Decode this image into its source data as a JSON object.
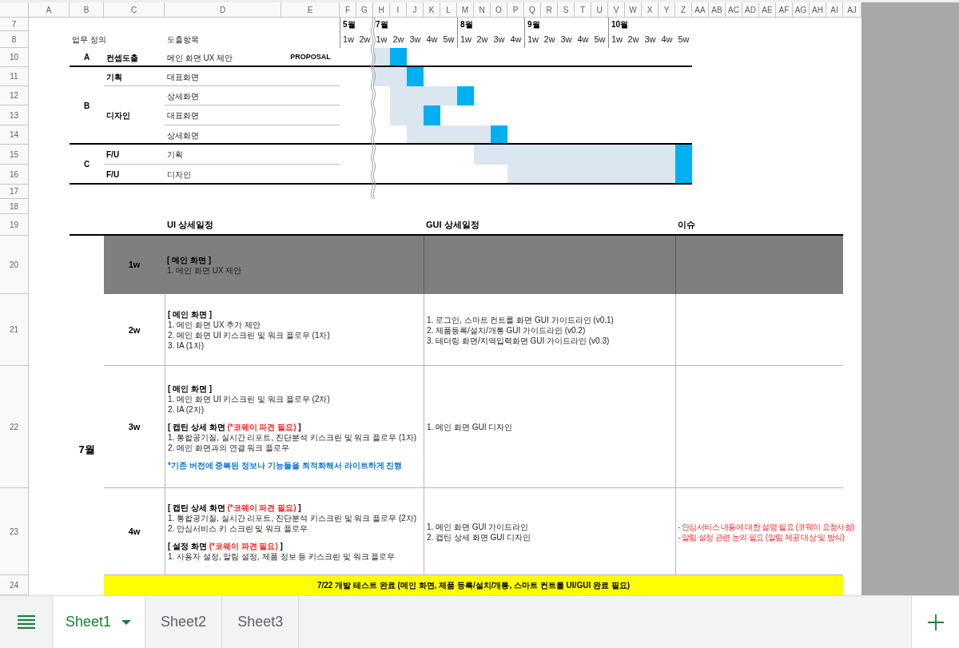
{
  "columns": [
    "A",
    "B",
    "C",
    "D",
    "E",
    "F",
    "G",
    "H",
    "I",
    "J",
    "K",
    "L",
    "M",
    "N",
    "O",
    "P",
    "Q",
    "R",
    "S",
    "T",
    "U",
    "V",
    "W",
    "X",
    "Y",
    "Z",
    "AA",
    "AB",
    "AC",
    "AD",
    "AE",
    "AF",
    "AG",
    "AH",
    "AI",
    "AJ"
  ],
  "row_numbers": [
    "7",
    "8",
    "10",
    "11",
    "12",
    "13",
    "14",
    "15",
    "16",
    "17",
    "18",
    "19",
    "20",
    "21",
    "22",
    "23",
    "24"
  ],
  "timeline": [
    {
      "month": "5월",
      "break": false,
      "weeks": [
        "1w",
        "2w"
      ]
    },
    {
      "month": "7월",
      "break": true,
      "weeks": [
        "1w",
        "2w",
        "3w",
        "4w",
        "5w"
      ]
    },
    {
      "month": "8월",
      "break": false,
      "weeks": [
        "1w",
        "2w",
        "3w",
        "4w"
      ]
    },
    {
      "month": "9월",
      "break": false,
      "weeks": [
        "1w",
        "2w",
        "3w",
        "4w",
        "5w"
      ]
    },
    {
      "month": "10월",
      "break": false,
      "weeks": [
        "1w",
        "2w",
        "3w",
        "4w",
        "5w"
      ]
    }
  ],
  "task_headers": {
    "definition": "업무 정의",
    "deliverable": "도출항목"
  },
  "tasks": [
    {
      "group": "A",
      "phases": [
        {
          "phase": "컨셉도출",
          "entries": [
            {
              "label": "메인 화면 UX 제안",
              "tag": "PROPOSAL",
              "week_cells": [
                {
                  "kind": "none"
                },
                {
                  "kind": "none"
                },
                {
                  "kind": "plan"
                },
                {
                  "kind": "due"
                },
                {
                  "kind": "none"
                },
                {
                  "kind": "none"
                },
                {
                  "kind": "none"
                },
                {
                  "kind": "none"
                },
                {
                  "kind": "none"
                },
                {
                  "kind": "none"
                },
                {
                  "kind": "none"
                },
                {
                  "kind": "none"
                },
                {
                  "kind": "none"
                },
                {
                  "kind": "none"
                },
                {
                  "kind": "none"
                },
                {
                  "kind": "none"
                },
                {
                  "kind": "none"
                },
                {
                  "kind": "none"
                },
                {
                  "kind": "none"
                },
                {
                  "kind": "none"
                },
                {
                  "kind": "none"
                }
              ]
            }
          ]
        }
      ]
    },
    {
      "group": "B",
      "phases": [
        {
          "phase": "기획",
          "entries": [
            {
              "label": "대표화면",
              "week_cells": [
                {
                  "kind": "none"
                },
                {
                  "kind": "none"
                },
                {
                  "kind": "plan"
                },
                {
                  "kind": "plan"
                },
                {
                  "kind": "due"
                },
                {
                  "kind": "none"
                },
                {
                  "kind": "none"
                },
                {
                  "kind": "none"
                },
                {
                  "kind": "none"
                },
                {
                  "kind": "none"
                },
                {
                  "kind": "none"
                },
                {
                  "kind": "none"
                },
                {
                  "kind": "none"
                },
                {
                  "kind": "none"
                },
                {
                  "kind": "none"
                },
                {
                  "kind": "none"
                },
                {
                  "kind": "none"
                },
                {
                  "kind": "none"
                },
                {
                  "kind": "none"
                },
                {
                  "kind": "none"
                },
                {
                  "kind": "none"
                }
              ]
            }
          ]
        },
        {
          "phase": "디자인",
          "entries": [
            {
              "label": "상세화면",
              "week_cells": [
                {
                  "kind": "none"
                },
                {
                  "kind": "none"
                },
                {
                  "kind": "none"
                },
                {
                  "kind": "plan"
                },
                {
                  "kind": "plan"
                },
                {
                  "kind": "plan"
                },
                {
                  "kind": "plan"
                },
                {
                  "kind": "due"
                },
                {
                  "kind": "none"
                },
                {
                  "kind": "none"
                },
                {
                  "kind": "none"
                },
                {
                  "kind": "none"
                },
                {
                  "kind": "none"
                },
                {
                  "kind": "none"
                },
                {
                  "kind": "none"
                },
                {
                  "kind": "none"
                },
                {
                  "kind": "none"
                },
                {
                  "kind": "none"
                },
                {
                  "kind": "none"
                },
                {
                  "kind": "none"
                },
                {
                  "kind": "none"
                }
              ]
            },
            {
              "label": "대표화면",
              "week_cells": [
                {
                  "kind": "none"
                },
                {
                  "kind": "none"
                },
                {
                  "kind": "none"
                },
                {
                  "kind": "plan"
                },
                {
                  "kind": "plan"
                },
                {
                  "kind": "due"
                },
                {
                  "kind": "none"
                },
                {
                  "kind": "none"
                },
                {
                  "kind": "none"
                },
                {
                  "kind": "none"
                },
                {
                  "kind": "none"
                },
                {
                  "kind": "none"
                },
                {
                  "kind": "none"
                },
                {
                  "kind": "none"
                },
                {
                  "kind": "none"
                },
                {
                  "kind": "none"
                },
                {
                  "kind": "none"
                },
                {
                  "kind": "none"
                },
                {
                  "kind": "none"
                },
                {
                  "kind": "none"
                },
                {
                  "kind": "none"
                }
              ]
            },
            {
              "label": "상세화면",
              "week_cells": [
                {
                  "kind": "none"
                },
                {
                  "kind": "none"
                },
                {
                  "kind": "none"
                },
                {
                  "kind": "none"
                },
                {
                  "kind": "plan"
                },
                {
                  "kind": "plan"
                },
                {
                  "kind": "plan"
                },
                {
                  "kind": "plan"
                },
                {
                  "kind": "plan"
                },
                {
                  "kind": "due"
                },
                {
                  "kind": "none"
                },
                {
                  "kind": "none"
                },
                {
                  "kind": "none"
                },
                {
                  "kind": "none"
                },
                {
                  "kind": "none"
                },
                {
                  "kind": "none"
                },
                {
                  "kind": "none"
                },
                {
                  "kind": "none"
                },
                {
                  "kind": "none"
                },
                {
                  "kind": "none"
                },
                {
                  "kind": "none"
                }
              ]
            }
          ]
        }
      ]
    },
    {
      "group": "C",
      "phases": [
        {
          "phase": "F/U",
          "entries": [
            {
              "label": "기획",
              "week_cells": [
                {
                  "kind": "none"
                },
                {
                  "kind": "none"
                },
                {
                  "kind": "none"
                },
                {
                  "kind": "none"
                },
                {
                  "kind": "none"
                },
                {
                  "kind": "none"
                },
                {
                  "kind": "none"
                },
                {
                  "kind": "none"
                },
                {
                  "kind": "plan"
                },
                {
                  "kind": "plan"
                },
                {
                  "kind": "plan"
                },
                {
                  "kind": "plan"
                },
                {
                  "kind": "plan"
                },
                {
                  "kind": "plan"
                },
                {
                  "kind": "plan"
                },
                {
                  "kind": "plan"
                },
                {
                  "kind": "plan"
                },
                {
                  "kind": "plan"
                },
                {
                  "kind": "plan"
                },
                {
                  "kind": "plan"
                },
                {
                  "kind": "due"
                }
              ]
            }
          ]
        },
        {
          "phase": "F/U",
          "entries": [
            {
              "label": "디자인",
              "week_cells": [
                {
                  "kind": "none"
                },
                {
                  "kind": "none"
                },
                {
                  "kind": "none"
                },
                {
                  "kind": "none"
                },
                {
                  "kind": "none"
                },
                {
                  "kind": "none"
                },
                {
                  "kind": "none"
                },
                {
                  "kind": "none"
                },
                {
                  "kind": "none"
                },
                {
                  "kind": "none"
                },
                {
                  "kind": "plan"
                },
                {
                  "kind": "plan"
                },
                {
                  "kind": "plan"
                },
                {
                  "kind": "plan"
                },
                {
                  "kind": "plan"
                },
                {
                  "kind": "plan"
                },
                {
                  "kind": "plan"
                },
                {
                  "kind": "plan"
                },
                {
                  "kind": "plan"
                },
                {
                  "kind": "plan"
                },
                {
                  "kind": "due"
                }
              ]
            }
          ]
        }
      ]
    }
  ],
  "schedule": {
    "headings": [
      "UI 상세일정",
      "GUI 상세일정",
      "이슈"
    ],
    "month": "7월",
    "rows": [
      {
        "week": "1w",
        "shaded": true,
        "ui": [
          {
            "lines": [
              {
                "kind": "heading",
                "text": "[ 메인 화면 ]"
              },
              {
                "kind": "item",
                "text": "1. 메인 화면 UX 제안"
              }
            ]
          }
        ]
      },
      {
        "week": "2w",
        "shaded": false,
        "ui": [
          {
            "lines": [
              {
                "kind": "heading",
                "text": "[ 메인 화면 ]"
              },
              {
                "kind": "item",
                "text": "1. 메인 화면 UX 추가 제안"
              },
              {
                "kind": "item",
                "text": "2. 메인 화면 UI 키스크린 및 워크 플로우 (1차)"
              },
              {
                "kind": "item",
                "text": "3. IA (1차)"
              }
            ]
          }
        ],
        "gui": [
          "1. 로그인, 스마트 컨트롤 화면 GUI 가이드라인 (v0.1)",
          "2. 제품등록/설치/개통 GUI 가이드라인 (v0.2)",
          "3. 테더링 화면/지역입력화면 GUI 가이드라인 (v0.3)"
        ]
      },
      {
        "week": "3w",
        "shaded": false,
        "ui": [
          {
            "lines": [
              {
                "kind": "heading",
                "text": "[ 메인 화면 ]"
              },
              {
                "kind": "item",
                "text": "1. 메인 화면 UI 키스크린 및 워크 플로우 (2차)"
              },
              {
                "kind": "item",
                "text": "2. IA (2차)"
              }
            ]
          },
          {
            "lines": [
              {
                "kind": "heading",
                "parts": [
                  {
                    "text": "[ 캡틴 상세 화면",
                    "alert": false
                  },
                  {
                    "text": "(*코웨이 파견 필요)",
                    "alert": true
                  },
                  {
                    "text": "]",
                    "alert": false
                  }
                ]
              },
              {
                "kind": "item",
                "text": "1. 통합공기질, 실시간 리포트, 진단분석 키스크린 및 워크 플로우 (1차)"
              },
              {
                "kind": "item",
                "text": "2. 메인 화면과의 연결 워크 플로우"
              }
            ]
          },
          {
            "lines": [
              {
                "kind": "note",
                "text": "*기존 버전에 중복된 정보나 기능들을 최적화해서 라이트하게 진행"
              }
            ]
          }
        ],
        "gui": [
          "1. 메인 화면 GUI 디자인"
        ]
      },
      {
        "week": "4w",
        "shaded": false,
        "ui": [
          {
            "lines": [
              {
                "kind": "heading",
                "parts": [
                  {
                    "text": "[ 캡틴 상세 화면",
                    "alert": false
                  },
                  {
                    "text": "(*코웨이 파견 필요)",
                    "alert": true
                  },
                  {
                    "text": "]",
                    "alert": false
                  }
                ]
              },
              {
                "kind": "item",
                "text": "1. 통합공기질, 실시간 리포트, 진단분석 키스크린 및 워크 플로우 (2차)"
              },
              {
                "kind": "item",
                "text": "2. 안심서비스 키 스크린 및 워크 플로우"
              }
            ]
          },
          {
            "lines": [
              {
                "kind": "heading",
                "parts": [
                  {
                    "text": "[ 설정 화면",
                    "alert": false
                  },
                  {
                    "text": "(*코웨이 파견 필요)",
                    "alert": true
                  },
                  {
                    "text": "]",
                    "alert": false
                  }
                ]
              },
              {
                "kind": "item",
                "text": "1. 사용자 설정, 알림 설정, 제품 정보 등 키스크린 및 워크 플로우"
              }
            ]
          }
        ],
        "gui": [
          "1. 메인 화면 GUI 가이드라인",
          "2. 캡틴 상세 화면 GUI 디자인"
        ],
        "issues": [
          "- 안심서비스 내용에 대한 설명 필요 (코웨이 요청사항)",
          "- 알림 설정 관련 논의 필요 (알림 제공 대상 및 방식)"
        ]
      }
    ],
    "milestone": "7/22 개발 테스트 완료 (메인 화면, 제품 등록/설치/개통, 스마트 컨트롤 UI/GUI 완료 필요)"
  },
  "sheet_tabs": [
    {
      "label": "Sheet1",
      "selected": true
    },
    {
      "label": "Sheet2",
      "selected": false
    },
    {
      "label": "Sheet3",
      "selected": false
    }
  ]
}
